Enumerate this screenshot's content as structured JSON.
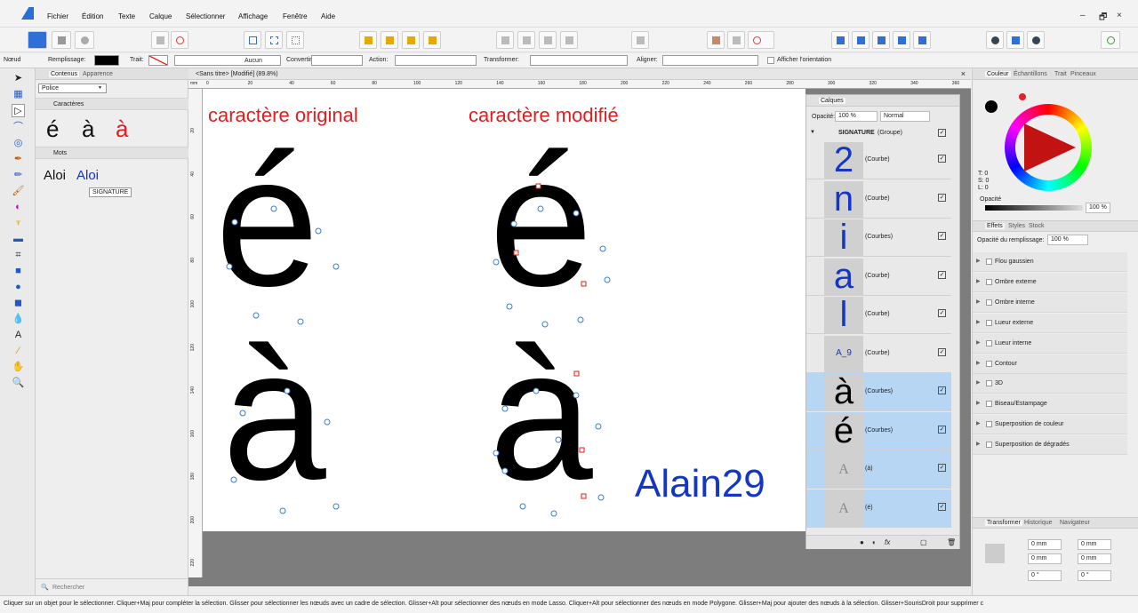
{
  "menu": [
    "Fichier",
    "Édition",
    "Texte",
    "Calque",
    "Sélectionner",
    "Affichage",
    "Fenêtre",
    "Aide"
  ],
  "window_controls": {
    "minimize": "–",
    "restore": "🗗",
    "close": "×"
  },
  "context": {
    "mode": "Nœud",
    "fill_label": "Remplissage:",
    "stroke_label": "Trait:",
    "stroke_none": "Aucun",
    "convert_label": "Convertir:",
    "action_label": "Action:",
    "transform_label": "Transformer:",
    "align_label": "Aligner:",
    "show_orientation": "Afficher l'orientation"
  },
  "left_panel": {
    "tab_contents": "Contenus",
    "tab_appearance": "Apparence",
    "font_dropdown": "Police",
    "section_chars": "Caractères",
    "chars": [
      "é",
      "à",
      "à"
    ],
    "section_words": "Mots",
    "words": [
      "Aloi",
      "Aloi"
    ],
    "tooltip": "SIGNATURE",
    "search_placeholder": "Rechercher"
  },
  "document": {
    "tab_title": "<Sans titre> [Modifié] (89.8%)",
    "ruler_unit": "mm",
    "h_ticks": [
      "0",
      "20",
      "40",
      "60",
      "80",
      "100",
      "120",
      "140",
      "160",
      "180",
      "200",
      "220",
      "240",
      "260",
      "280",
      "300",
      "320",
      "340",
      "360"
    ],
    "v_ticks": [
      "20",
      "40",
      "60",
      "80",
      "100",
      "120",
      "140",
      "160",
      "180",
      "200",
      "220"
    ]
  },
  "canvas": {
    "label_original": "caractère original",
    "label_modified": "caractère modifié",
    "char_e": "é",
    "char_a": "à",
    "signature": "Alain29"
  },
  "layers": {
    "title": "Calques",
    "opacity_label": "Opacité:",
    "opacity_value": "100 %",
    "blend_value": "Normal",
    "group_name": "SIGNATURE",
    "group_suffix": "(Groupe)",
    "rows": [
      {
        "label": "(Courbe)",
        "thumb": "2",
        "selected": false
      },
      {
        "label": "(Courbe)",
        "thumb": "n",
        "selected": false
      },
      {
        "label": "(Courbes)",
        "thumb": "i",
        "selected": false
      },
      {
        "label": "(Courbe)",
        "thumb": "a",
        "selected": false
      },
      {
        "label": "(Courbe)",
        "thumb": "l",
        "selected": false
      },
      {
        "label": "(Courbe)",
        "thumb": "A_9",
        "selected": false
      },
      {
        "label": "(Courbes)",
        "thumb": "à",
        "selected": true
      },
      {
        "label": "(Courbes)",
        "thumb": "é",
        "selected": true
      },
      {
        "label": "(à)",
        "thumb": "A",
        "selected": true
      },
      {
        "label": "(é)",
        "thumb": "A",
        "selected": true
      }
    ]
  },
  "color_panel": {
    "tabs": [
      "Couleur",
      "Échantillons",
      "Trait",
      "Pinceaux"
    ],
    "t": "T: 0",
    "s": "S: 0",
    "l": "L: 0",
    "opacity_label": "Opacité",
    "opacity_value": "100 %",
    "fill_color": "#e8202a"
  },
  "effects_panel": {
    "tabs": [
      "Effets",
      "Styles",
      "Stock"
    ],
    "fill_opacity_label": "Opacité du remplissage:",
    "fill_opacity_value": "100 %",
    "effects": [
      "Flou gaussien",
      "Ombre externe",
      "Ombre interne",
      "Lueur externe",
      "Lueur interne",
      "Contour",
      "3D",
      "Biseau/Estampage",
      "Superposition de couleur",
      "Superposition de dégradés"
    ]
  },
  "transform_panel": {
    "tabs": [
      "Transformer",
      "Historique",
      "Navigateur"
    ],
    "x": "0 mm",
    "y": "0 mm",
    "l": "0 mm",
    "h": "0 mm",
    "r": "0 °",
    "s": "0 °"
  },
  "status": {
    "text": "Cliquer sur un objet pour le sélectionner. Cliquer+Maj pour compléter la sélection. Glisser pour sélectionner les nœuds avec un cadre de sélection. Glisser+Alt pour sélectionner des nœuds en mode Lasso. Cliquer+Alt pour sélectionner des nœuds en mode Polygone. Glisser+Maj pour ajouter des nœuds à la sélection. Glisser+SourisDroit pour supprimer c"
  },
  "colors": {
    "accent": "#2f6fd8",
    "red": "#e11e1e",
    "sig_blue": "#1336c4"
  }
}
